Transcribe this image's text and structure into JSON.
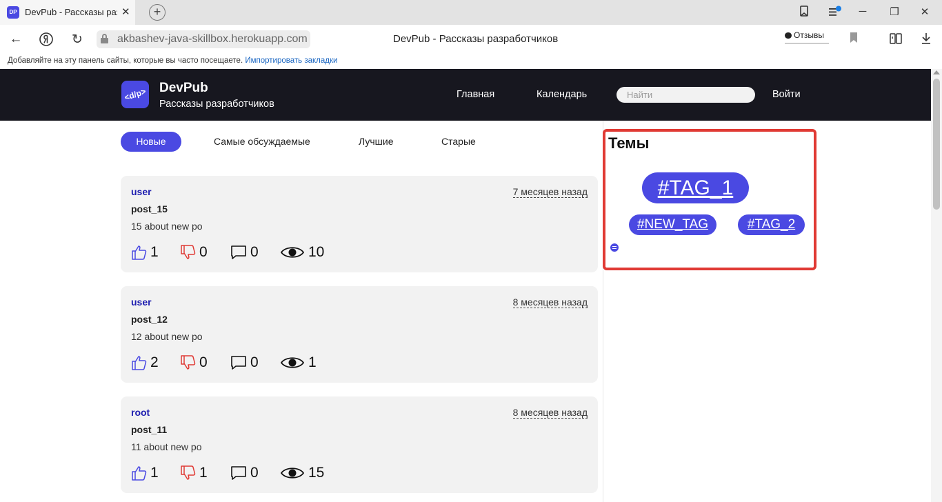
{
  "browser": {
    "tab_title": "DevPub - Рассказы разработчиков",
    "tab_favicon": "DP",
    "url": "akbashev-java-skillbox.herokuapp.com",
    "page_title": "DevPub - Рассказы разработчиков",
    "feedback_label": "Отзывы",
    "bookmarks_hint": "Добавляйте на эту панель сайты, которые вы часто посещаете.",
    "bookmarks_import": "Импортировать закладки"
  },
  "site": {
    "logo_text": "<d/p>",
    "brand": "DevPub",
    "tagline": "Рассказы разработчиков",
    "nav": {
      "home": "Главная",
      "calendar": "Календарь",
      "login": "Войти"
    },
    "search_placeholder": "Найти",
    "accent_color": "#4a49e2",
    "header_bg": "#17171f"
  },
  "filters": {
    "tabs": [
      "Новые",
      "Самые обсуждаемые",
      "Лучшие",
      "Старые"
    ],
    "active": "Новые"
  },
  "posts": [
    {
      "author": "user",
      "time": "7 месяцев назад",
      "title": "post_15",
      "excerpt": "15 about new po",
      "likes": "1",
      "dislikes": "0",
      "comments": "0",
      "views": "10"
    },
    {
      "author": "user",
      "time": "8 месяцев назад",
      "title": "post_12",
      "excerpt": "12 about new po",
      "likes": "2",
      "dislikes": "0",
      "comments": "0",
      "views": "1"
    },
    {
      "author": "root",
      "time": "8 месяцев назад",
      "title": "post_11",
      "excerpt": "11 about new po",
      "likes": "1",
      "dislikes": "1",
      "comments": "0",
      "views": "15"
    }
  ],
  "topics": {
    "title": "Темы",
    "tags": [
      "#TAG_1",
      "#NEW_TAG",
      "#TAG_2"
    ],
    "highlight_color": "#e03a34"
  }
}
